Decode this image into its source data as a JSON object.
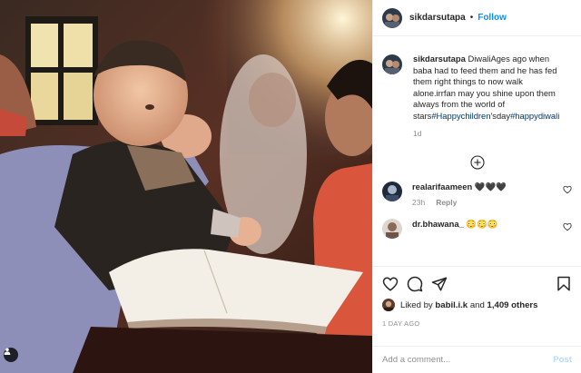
{
  "header": {
    "username": "sikdarsutapa",
    "separator": "•",
    "follow_label": "Follow"
  },
  "caption": {
    "username": "sikdarsutapa",
    "text_part1": "DiwaliAges ago when baba had to feed them and he has fed them right things to now walk alone.irrfan may you shine upon them always from the world of stars",
    "hashtag1": "#Happychildren",
    "text_part2": "'sday",
    "hashtag2": "#happydiwali",
    "time": "1d"
  },
  "comments": [
    {
      "username": "realarifaameen",
      "text": "🖤🖤🖤",
      "time": "23h",
      "reply_label": "Reply"
    },
    {
      "username": "dr.bhawana_",
      "text": "😳😳😳",
      "time": "",
      "reply_label": ""
    }
  ],
  "likes": {
    "prefix": "Liked by",
    "user": "babil.i.k",
    "middle": "and",
    "count": "1,409 others"
  },
  "date": "1 DAY AGO",
  "add_comment": {
    "placeholder": "Add a comment...",
    "post_label": "Post"
  },
  "colors": {
    "accent": "#0095f6",
    "post_disabled": "#b3dbff",
    "secondary_text": "#8e8e8e",
    "hashtag": "#00376b"
  }
}
